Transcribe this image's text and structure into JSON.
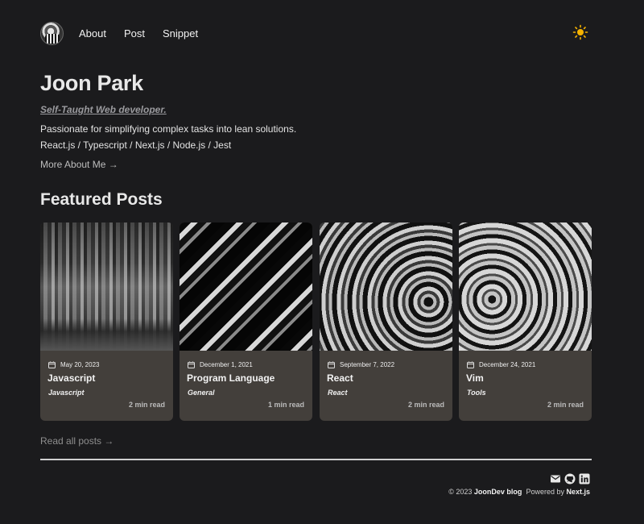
{
  "header": {
    "nav": [
      "About",
      "Post",
      "Snippet"
    ]
  },
  "intro": {
    "name": "Joon Park",
    "tagline": "Self-Taught Web developer.",
    "description": "Passionate for simplifying complex tasks into lean solutions.",
    "stack": "React.js / Typescript / Next.js / Node.js / Jest",
    "more_link": "More About Me →"
  },
  "featured": {
    "title": "Featured Posts",
    "posts": [
      {
        "date": "May 20, 2023",
        "title": "Javascript",
        "category": "Javascript",
        "read_time": "2 min read"
      },
      {
        "date": "December 1, 2021",
        "title": "Program Language",
        "category": "General",
        "read_time": "1 min read"
      },
      {
        "date": "September 7, 2022",
        "title": "React",
        "category": "React",
        "read_time": "2 min read"
      },
      {
        "date": "December 24, 2021",
        "title": "Vim",
        "category": "Tools",
        "read_time": "2 min read"
      }
    ],
    "read_all": "Read all posts →"
  },
  "footer": {
    "copyright": "© 2023",
    "brand": "JoonDev blog",
    "powered": "Powered by",
    "framework": "Next.js",
    "social_icons": [
      "mail-icon",
      "github-icon",
      "linkedin-icon"
    ]
  },
  "colors": {
    "background": "#1b1b1d",
    "card": "#433f3b",
    "sun": "#f5b301"
  }
}
